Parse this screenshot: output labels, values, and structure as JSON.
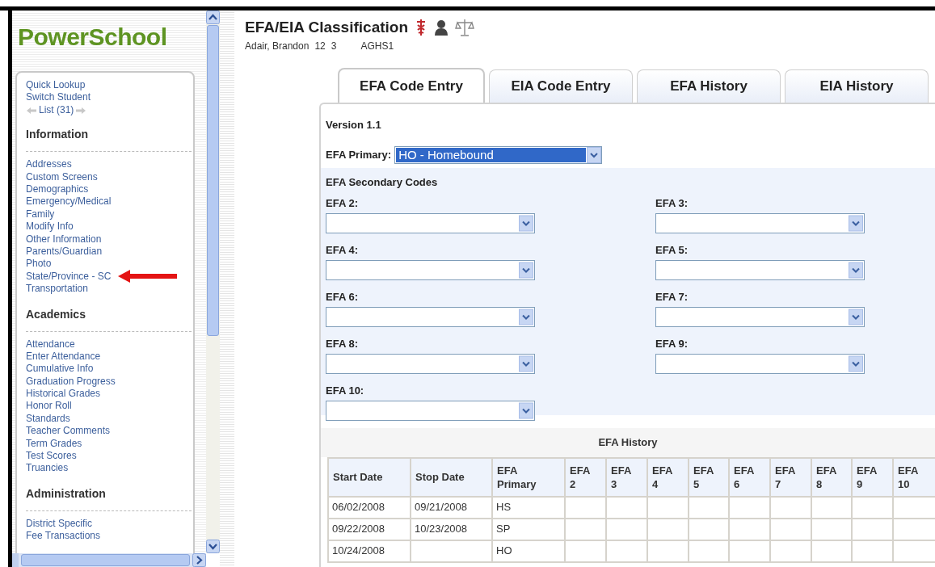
{
  "sidebar": {
    "logo": "PowerSchool",
    "quick_links": [
      "Quick Lookup",
      "Switch Student"
    ],
    "student_list": "List (31)",
    "sections": [
      {
        "title": "Information",
        "items": [
          {
            "label": "Addresses",
            "annotated": false
          },
          {
            "label": "Custom Screens",
            "annotated": false
          },
          {
            "label": "Demographics",
            "annotated": false
          },
          {
            "label": "Emergency/Medical",
            "annotated": false
          },
          {
            "label": "Family",
            "annotated": false
          },
          {
            "label": "Modify Info",
            "annotated": false
          },
          {
            "label": "Other Information",
            "annotated": false
          },
          {
            "label": "Parents/Guardian",
            "annotated": false
          },
          {
            "label": "Photo",
            "annotated": false
          },
          {
            "label": "State/Province - SC",
            "annotated": true
          },
          {
            "label": "Transportation",
            "annotated": false
          }
        ]
      },
      {
        "title": "Academics",
        "items": [
          {
            "label": "Attendance",
            "annotated": false
          },
          {
            "label": "Enter Attendance",
            "annotated": false
          },
          {
            "label": "Cumulative Info",
            "annotated": false
          },
          {
            "label": "Graduation Progress",
            "annotated": false
          },
          {
            "label": "Historical Grades",
            "annotated": false
          },
          {
            "label": "Honor Roll",
            "annotated": false
          },
          {
            "label": "Standards",
            "annotated": false
          },
          {
            "label": "Teacher Comments",
            "annotated": false
          },
          {
            "label": "Term Grades",
            "annotated": false
          },
          {
            "label": "Test Scores",
            "annotated": false
          },
          {
            "label": "Truancies",
            "annotated": false
          }
        ]
      },
      {
        "title": "Administration",
        "items": [
          {
            "label": "District Specific",
            "annotated": false
          },
          {
            "label": "Fee Transactions",
            "annotated": false
          }
        ]
      }
    ]
  },
  "header": {
    "title": "EFA/EIA Classification",
    "student_name": "Adair, Brandon",
    "grade": "12",
    "track": "3",
    "school": "AGHS1"
  },
  "tabs": [
    {
      "label": "EFA Code Entry",
      "selected": true
    },
    {
      "label": "EIA Code Entry",
      "selected": false
    },
    {
      "label": "EFA History",
      "selected": false
    },
    {
      "label": "EIA History",
      "selected": false
    }
  ],
  "form": {
    "version": "Version 1.1",
    "primary": {
      "label": "EFA Primary:",
      "value": "HO - Homebound"
    },
    "secondary_title": "EFA Secondary Codes",
    "secondary_fields": [
      {
        "label": "EFA 2:"
      },
      {
        "label": "EFA 3:"
      },
      {
        "label": "EFA 4:"
      },
      {
        "label": "EFA 5:"
      },
      {
        "label": "EFA 6:"
      },
      {
        "label": "EFA 7:"
      },
      {
        "label": "EFA 8:"
      },
      {
        "label": "EFA 9:"
      },
      {
        "label": "EFA 10:"
      }
    ]
  },
  "history": {
    "title": "EFA History",
    "columns": [
      "Start Date",
      "Stop Date",
      "EFA Primary",
      "EFA 2",
      "EFA 3",
      "EFA 4",
      "EFA 5",
      "EFA 6",
      "EFA 7",
      "EFA 8",
      "EFA 9",
      "EFA 10"
    ],
    "rows": [
      [
        "06/02/2008",
        "09/21/2008",
        "HS",
        "",
        "",
        "",
        "",
        "",
        "",
        "",
        "",
        ""
      ],
      [
        "09/22/2008",
        "10/23/2008",
        "SP",
        "",
        "",
        "",
        "",
        "",
        "",
        "",
        "",
        ""
      ],
      [
        "10/24/2008",
        "",
        "HO",
        "",
        "",
        "",
        "",
        "",
        "",
        "",
        "",
        ""
      ]
    ]
  }
}
